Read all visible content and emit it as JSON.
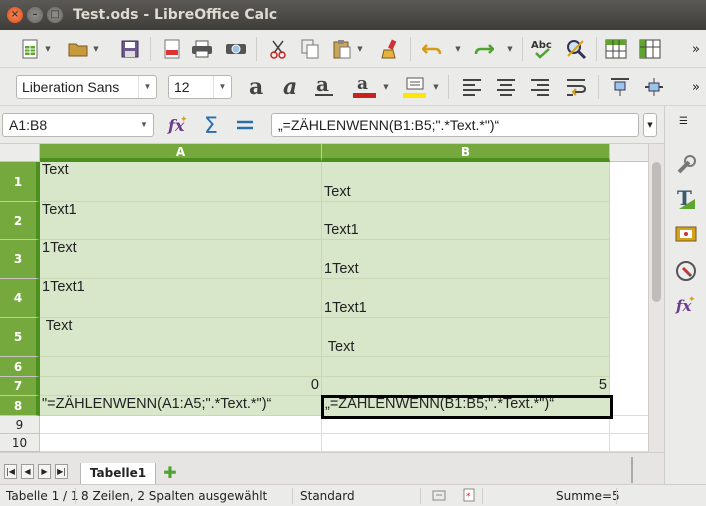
{
  "window": {
    "title": "Test.ods - LibreOffice Calc",
    "close_glyph": "×",
    "min_glyph": "–",
    "max_glyph": "□"
  },
  "toolbar2": {
    "font_name": "Liberation Sans",
    "font_size": "12"
  },
  "formula_bar": {
    "name_box": "A1:B8",
    "formula": "„=ZÄHLENWENN(B1:B5;\".*Text.*\")“"
  },
  "columns": [
    {
      "label": "A"
    },
    {
      "label": "B"
    }
  ],
  "rows": [
    "1",
    "2",
    "3",
    "4",
    "5",
    "6",
    "7",
    "8",
    "9",
    "10"
  ],
  "cells": {
    "a1": "Text",
    "b1": "Text",
    "a2": "Text1",
    "b2": "Text1",
    "a3": "1Text",
    "b3": "1Text",
    "a4": "1Text1",
    "b4": "1Text1",
    "a5": " Text",
    "b5": " Text",
    "a7": "0",
    "b7": "5",
    "a8": "\"=ZÄHLENWENN(A1:A5;\".*Text.*\")“",
    "b8": "„=ZÄHLENWENN(B1:B5;\".*Text.*\")“"
  },
  "sheets": {
    "active_tab": "Tabelle1"
  },
  "status": {
    "sheet": "Tabelle 1 / 1",
    "selection": "8 Zeilen, 2 Spalten ausgewählt",
    "page_style": "Standard",
    "sum": "Summe=5"
  },
  "colors": {
    "selection_header": "#76a93d",
    "selection_header_border": "#4c8f1c",
    "selection_cell": "#d8e6c9",
    "title_bar": "#3e3d39"
  }
}
